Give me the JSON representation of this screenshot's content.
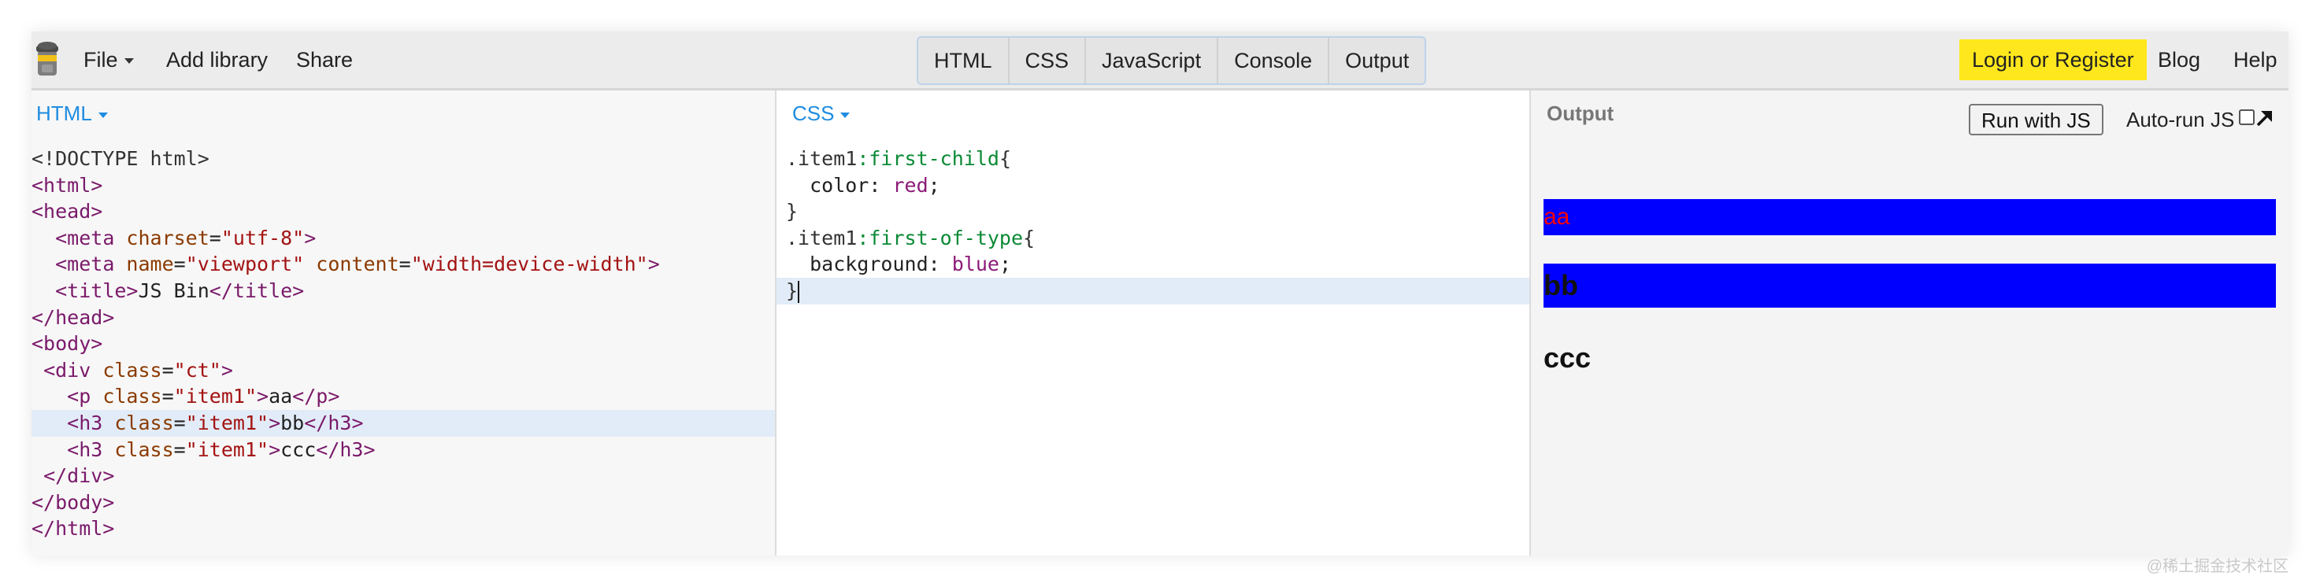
{
  "topbar": {
    "menu": {
      "file": "File",
      "add_library": "Add library",
      "share": "Share"
    },
    "tabs": [
      {
        "label": "HTML",
        "active": true
      },
      {
        "label": "CSS",
        "active": true
      },
      {
        "label": "JavaScript",
        "active": false
      },
      {
        "label": "Console",
        "active": false
      },
      {
        "label": "Output",
        "active": true
      }
    ],
    "right": {
      "login": "Login or Register",
      "blog": "Blog",
      "help": "Help"
    }
  },
  "panels": {
    "html": {
      "label": "HTML",
      "lines": [
        [
          [
            "doctype",
            "<!DOCTYPE html>"
          ]
        ],
        [
          [
            "tag",
            "<html>"
          ]
        ],
        [
          [
            "tag",
            "<head>"
          ]
        ],
        [
          [
            "plain",
            "  "
          ],
          [
            "tag",
            "<meta "
          ],
          [
            "attr",
            "charset"
          ],
          [
            "plain",
            "="
          ],
          [
            "str",
            "\"utf-8\""
          ],
          [
            "tag",
            ">"
          ]
        ],
        [
          [
            "plain",
            "  "
          ],
          [
            "tag",
            "<meta "
          ],
          [
            "attr",
            "name"
          ],
          [
            "plain",
            "="
          ],
          [
            "str",
            "\"viewport\""
          ],
          [
            "plain",
            " "
          ],
          [
            "attr",
            "content"
          ],
          [
            "plain",
            "="
          ],
          [
            "str",
            "\"width=device-width\""
          ],
          [
            "tag",
            ">"
          ]
        ],
        [
          [
            "plain",
            "  "
          ],
          [
            "tag",
            "<title>"
          ],
          [
            "plain",
            "JS Bin"
          ],
          [
            "tag",
            "</title>"
          ]
        ],
        [
          [
            "tag",
            "</head>"
          ]
        ],
        [
          [
            "tag",
            "<body>"
          ]
        ],
        [
          [
            "plain",
            " "
          ],
          [
            "tag",
            "<div "
          ],
          [
            "attr",
            "class"
          ],
          [
            "plain",
            "="
          ],
          [
            "str",
            "\"ct\""
          ],
          [
            "tag",
            ">"
          ]
        ],
        [
          [
            "plain",
            "   "
          ],
          [
            "tag",
            "<p "
          ],
          [
            "attr",
            "class"
          ],
          [
            "plain",
            "="
          ],
          [
            "str",
            "\"item1\""
          ],
          [
            "tag",
            ">"
          ],
          [
            "plain",
            "aa"
          ],
          [
            "tag",
            "</p>"
          ]
        ],
        [
          [
            "plain",
            "   "
          ],
          [
            "tag",
            "<h3 "
          ],
          [
            "attr",
            "class"
          ],
          [
            "plain",
            "="
          ],
          [
            "str",
            "\"item1\""
          ],
          [
            "tag",
            ">"
          ],
          [
            "plain",
            "bb"
          ],
          [
            "tag",
            "</h3>"
          ]
        ],
        [
          [
            "plain",
            "   "
          ],
          [
            "tag",
            "<h3 "
          ],
          [
            "attr",
            "class"
          ],
          [
            "plain",
            "="
          ],
          [
            "str",
            "\"item1\""
          ],
          [
            "tag",
            ">"
          ],
          [
            "plain",
            "ccc"
          ],
          [
            "tag",
            "</h3>"
          ]
        ],
        [
          [
            "plain",
            " "
          ],
          [
            "tag",
            "</div>"
          ]
        ],
        [
          [
            "tag",
            "</body>"
          ]
        ],
        [
          [
            "tag",
            "</html>"
          ]
        ]
      ],
      "highlight_line": 10
    },
    "css": {
      "label": "CSS",
      "lines": [
        [
          [
            "sel",
            ".item1"
          ],
          [
            "pseudo",
            ":first-child"
          ],
          [
            "sel",
            "{"
          ]
        ],
        [
          [
            "prop",
            "  color: "
          ],
          [
            "val",
            "red"
          ],
          [
            "prop",
            ";"
          ]
        ],
        [
          [
            "sel",
            "}"
          ]
        ],
        [
          [
            "sel",
            ".item1"
          ],
          [
            "pseudo",
            ":first-of-type"
          ],
          [
            "sel",
            "{"
          ]
        ],
        [
          [
            "prop",
            "  background: "
          ],
          [
            "val",
            "blue"
          ],
          [
            "prop",
            ";"
          ]
        ],
        [
          [
            "sel",
            "}"
          ]
        ]
      ],
      "highlight_line": 5
    },
    "output": {
      "title": "Output",
      "run_button": "Run with JS",
      "autorun_label": "Auto-run JS",
      "rendered": {
        "p": "aa",
        "h3_first": "bb",
        "h3_second": "ccc"
      }
    }
  },
  "watermark": "@稀土掘金技术社区",
  "colors": {
    "accent_blue": "#1f8ce0",
    "login_yellow": "#ffe71d",
    "output_bg_blue": "#0000ff",
    "output_text_red": "#ff0000"
  }
}
